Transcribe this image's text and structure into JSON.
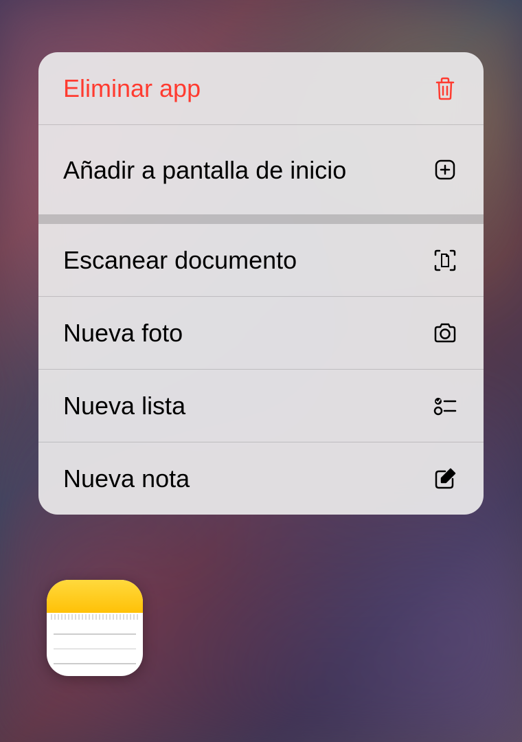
{
  "menu": {
    "items": [
      {
        "label": "Eliminar app",
        "icon": "trash-icon",
        "destructive": true
      },
      {
        "label": "Añadir a pantalla de inicio",
        "icon": "plus-square-icon"
      },
      {
        "label": "Escanear documento",
        "icon": "scan-document-icon"
      },
      {
        "label": "Nueva foto",
        "icon": "camera-icon"
      },
      {
        "label": "Nueva lista",
        "icon": "checklist-icon"
      },
      {
        "label": "Nueva nota",
        "icon": "compose-icon"
      }
    ]
  },
  "app": {
    "name": "Notas"
  },
  "colors": {
    "destructive": "#ff3b30",
    "text": "#000000"
  }
}
